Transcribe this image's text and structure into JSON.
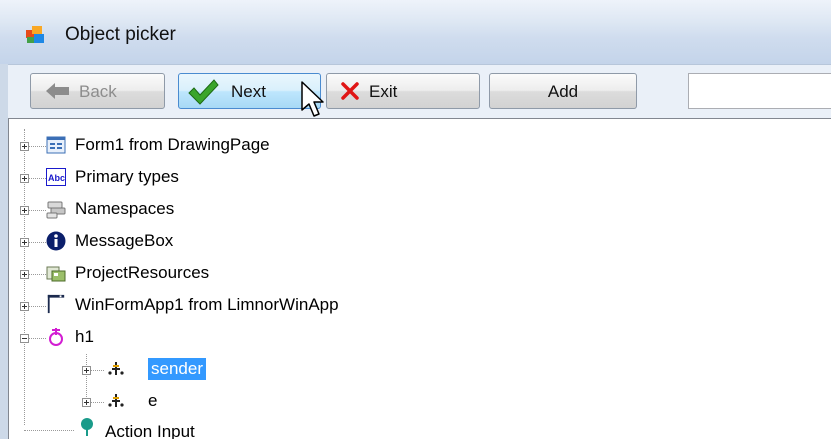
{
  "window": {
    "title": "Object picker",
    "icon": "app-windows-icon"
  },
  "toolbar": {
    "back_label": "Back",
    "next_label": "Next",
    "exit_label": "Exit",
    "add_label": "Add",
    "search_value": ""
  },
  "tree": {
    "nodes": [
      {
        "label": "Form1 from DrawingPage",
        "icon": "form-icon",
        "expanded": false
      },
      {
        "label": "Primary types",
        "icon": "abc-type-icon",
        "expanded": false
      },
      {
        "label": "Namespaces",
        "icon": "namespace-icon",
        "expanded": false
      },
      {
        "label": "MessageBox",
        "icon": "info-icon",
        "expanded": false
      },
      {
        "label": "ProjectResources",
        "icon": "resources-icon",
        "expanded": false
      },
      {
        "label": "WinFormApp1 from LimnorWinApp",
        "icon": "window-icon",
        "expanded": false
      },
      {
        "label": "h1",
        "icon": "handler-icon",
        "expanded": true,
        "children": [
          {
            "label": "sender",
            "icon": "parameter-icon",
            "expanded": false,
            "selected": true
          },
          {
            "label": "e",
            "icon": "parameter-icon",
            "expanded": false
          }
        ]
      },
      {
        "label": "Action Input",
        "icon": "pin-icon",
        "expanded": false
      }
    ]
  },
  "colors": {
    "selection": "#3399ff",
    "titlebar": "#dde7f3"
  }
}
